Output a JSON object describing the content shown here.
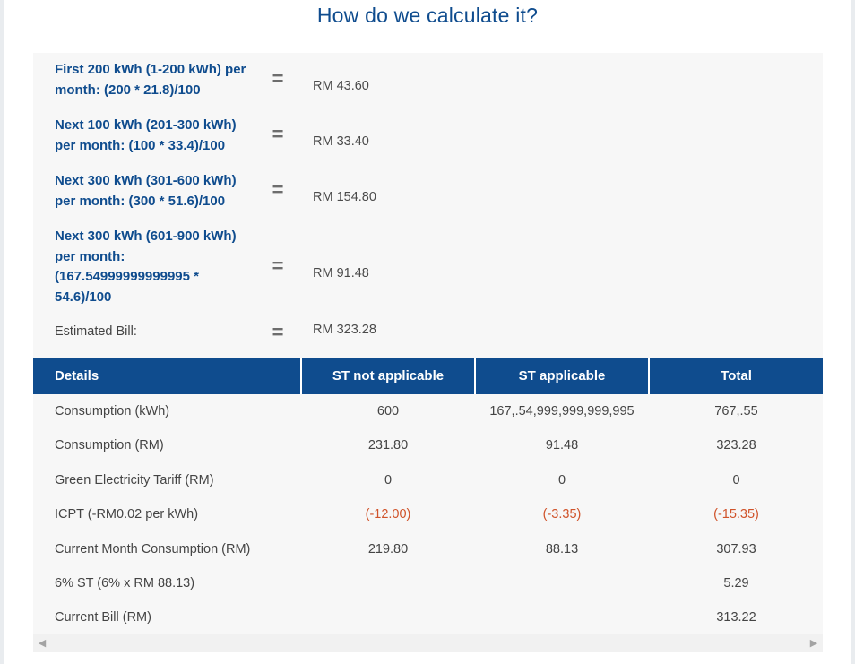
{
  "title": "How do we calculate it?",
  "calc": [
    {
      "label": "First 200 kWh (1-200 kWh) per month: (200 * 21.8)/100",
      "eq": "=",
      "value": "RM 43.60"
    },
    {
      "label": "Next 100 kWh (201-300 kWh) per month: (100 * 33.4)/100",
      "eq": "=",
      "value": "RM 33.40"
    },
    {
      "label": "Next 300 kWh (301-600 kWh) per month: (300 * 51.6)/100",
      "eq": "=",
      "value": "RM 154.80"
    },
    {
      "label": "Next 300 kWh (601-900 kWh) per month: (167.54999999999995 * 54.6)/100",
      "eq": "=",
      "value": "RM 91.48"
    },
    {
      "label": "Estimated Bill:",
      "eq": "=",
      "value": "RM 323.28"
    }
  ],
  "table": {
    "headers": [
      "Details",
      "ST not applicable",
      "ST applicable",
      "Total"
    ],
    "rows": [
      [
        "Consumption (kWh)",
        "600",
        "167,.54,999,999,999,995",
        "767,.55"
      ],
      [
        "Consumption (RM)",
        "231.80",
        "91.48",
        "323.28"
      ],
      [
        "Green Electricity Tariff (RM)",
        "0",
        "0",
        "0"
      ],
      [
        "ICPT (-RM0.02 per kWh)",
        "(-12.00)",
        "(-3.35)",
        "(-15.35)"
      ],
      [
        "Current Month Consumption (RM)",
        "219.80",
        "88.13",
        "307.93"
      ],
      [
        "6% ST (6% x RM 88.13)",
        "",
        "",
        "5.29"
      ],
      [
        "Current Bill (RM)",
        "",
        "",
        "313.22"
      ]
    ]
  },
  "colors": {
    "accent": "#0f4c8e",
    "negative": "#d0532a",
    "panel": "#f7f7f7"
  },
  "scrollbar": {
    "left_icon": "caret-left-icon",
    "right_icon": "caret-right-icon"
  }
}
